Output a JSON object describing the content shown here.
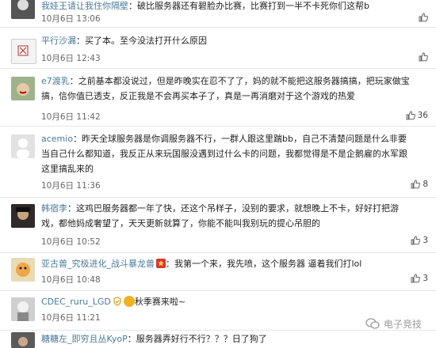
{
  "comments": [
    {
      "user": "我娃王请让我住你隔壁",
      "text": "：破比服务器还有碧脸办比赛，比赛打到一半不卡死你们这帮b",
      "date": "10月6日",
      "time": "13:06",
      "likes": ""
    },
    {
      "user": "平行沙漏",
      "text": "：买了本。至今没法打开什么原因",
      "date": "10月6日",
      "time": "12:43",
      "likes": ""
    },
    {
      "user": "e7渡乳",
      "text": "：之前基本都没说过，但是昨晚实在忍不了了，妈的就不能把这服务器搞搞，把玩家做宝搞，信你值已透支，反正我是不会再买本子了，真是一再消磨对于这个游戏的热爱",
      "date": "10月6日",
      "time": "11:42",
      "likes": "36"
    },
    {
      "user": "acemio",
      "text": "：昨天全球服务器是你调服务器不行，一群人跟这里踹bb，自己不清楚问题是什么非要当自己什么都知道，我反正从来玩国服没遇到过什么卡的问题，我都觉得是不是企鹅雇的水军跟这里搞乱来的",
      "date": "10月6日",
      "time": "11:36",
      "likes": "8"
    },
    {
      "user": "韩宿李",
      "text": "：这鸡巴服务器都一年了快，还这个吊样子，没别的要求，就想晚上不卡，好好打把游戏，都他妈成奢望了，天天更新就算了，你能不能叫我别玩的提心吊胆的",
      "date": "10月6日",
      "time": "10:52",
      "likes": "3"
    },
    {
      "user": "亚古兽_究极进化_战斗暴龙兽",
      "text": "：我第一个来，我先喷，这个服务器 逼着我们打lol",
      "date": "10月6日",
      "time": "10:48",
      "likes": "3"
    },
    {
      "user": "CDEC_ruru_LGD",
      "text": "秋季赛来啦~",
      "date": "10月6日",
      "time": "11:21",
      "likes": ""
    },
    {
      "user": "糖糖左_即穷且丛KyoP",
      "text": "：服务器弄好行不行？？？日了狗了",
      "date": "",
      "time": "",
      "likes": ""
    }
  ],
  "watermark": "电子竞技",
  "colors": {
    "username": "#4a7a9a",
    "divider": "#e6e6e6"
  }
}
